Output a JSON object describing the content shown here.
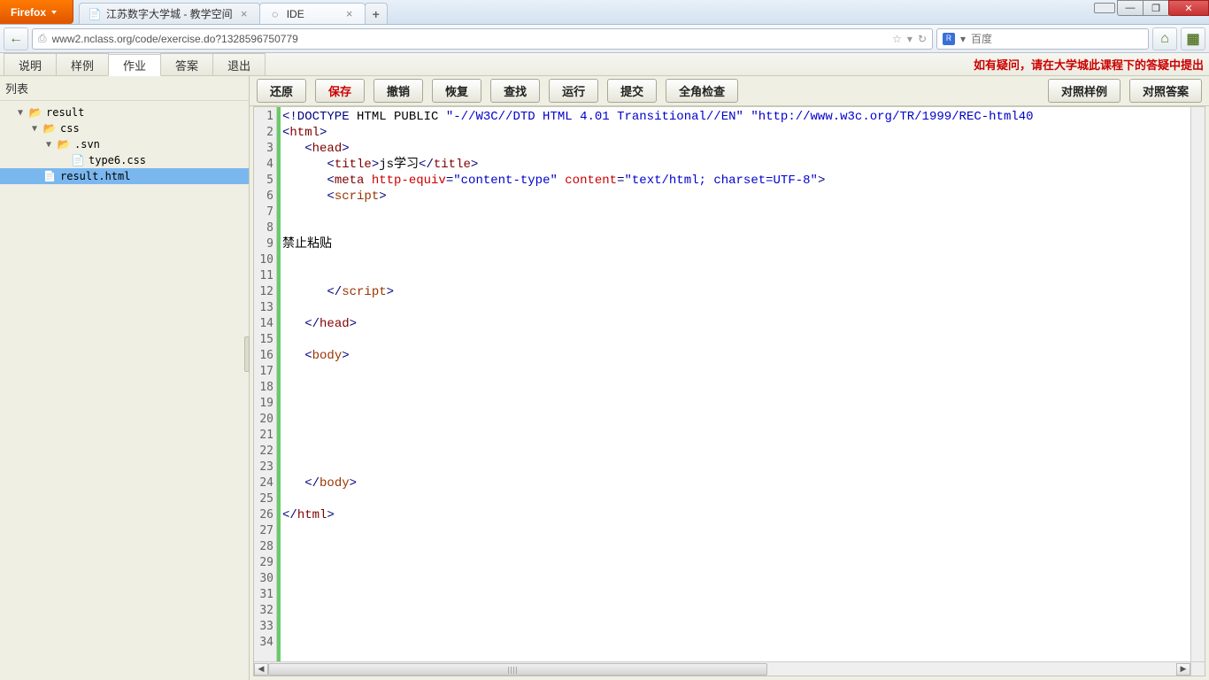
{
  "browser": {
    "name": "Firefox",
    "tabs": [
      {
        "label": "江苏数字大学城 - 教学空间",
        "active": false
      },
      {
        "label": "IDE",
        "active": true
      }
    ],
    "url": "www2.nclass.org/code/exercise.do?1328596750779",
    "search_placeholder": "百度"
  },
  "menu": {
    "items": [
      "说明",
      "样例",
      "作业",
      "答案",
      "退出"
    ],
    "active_index": 2,
    "notice": "如有疑问，请在大学城此课程下的答疑中提出"
  },
  "sidebar": {
    "title": "列表",
    "tree": {
      "n0": "result",
      "n1": "css",
      "n2": ".svn",
      "n3": "type6.css",
      "n4": "result.html"
    }
  },
  "toolbar": {
    "left": [
      "还原",
      "保存",
      "撤销",
      "恢复",
      "查找",
      "运行",
      "提交",
      "全角检查"
    ],
    "right": [
      "对照样例",
      "对照答案"
    ],
    "red_index": 1
  },
  "editor": {
    "line_count": 34,
    "lines": {
      "l1a": "<!DOCTYPE",
      "l1b": " HTML PUBLIC ",
      "l1c": "\"-//W3C//DTD HTML 4.01 Transitional//EN\"",
      "l1d": " ",
      "l1e": "\"http://www.w3c.org/TR/1999/REC-html40",
      "l2a": "<",
      "l2b": "html",
      "l2c": ">",
      "l3a": "   <",
      "l3b": "head",
      "l3c": ">",
      "l4a": "      <",
      "l4b": "title",
      "l4c": ">",
      "l4d": "js学习",
      "l4e": "</",
      "l4f": "title",
      "l4g": ">",
      "l5a": "      <",
      "l5b": "meta",
      "l5c": " http-equiv",
      "l5d": "=",
      "l5e": "\"content-type\"",
      "l5f": " content",
      "l5g": "=",
      "l5h": "\"text/html; charset=UTF-8\"",
      "l5i": ">",
      "l6a": "      <",
      "l6b": "script",
      "l6c": ">",
      "l9": "禁止粘贴",
      "l12a": "      </",
      "l12b": "script",
      "l12c": ">",
      "l14a": "   </",
      "l14b": "head",
      "l14c": ">",
      "l16a": "   <",
      "l16b": "body",
      "l16c": ">",
      "l24a": "   </",
      "l24b": "body",
      "l24c": ">",
      "l26a": "</",
      "l26b": "html",
      "l26c": ">"
    }
  }
}
